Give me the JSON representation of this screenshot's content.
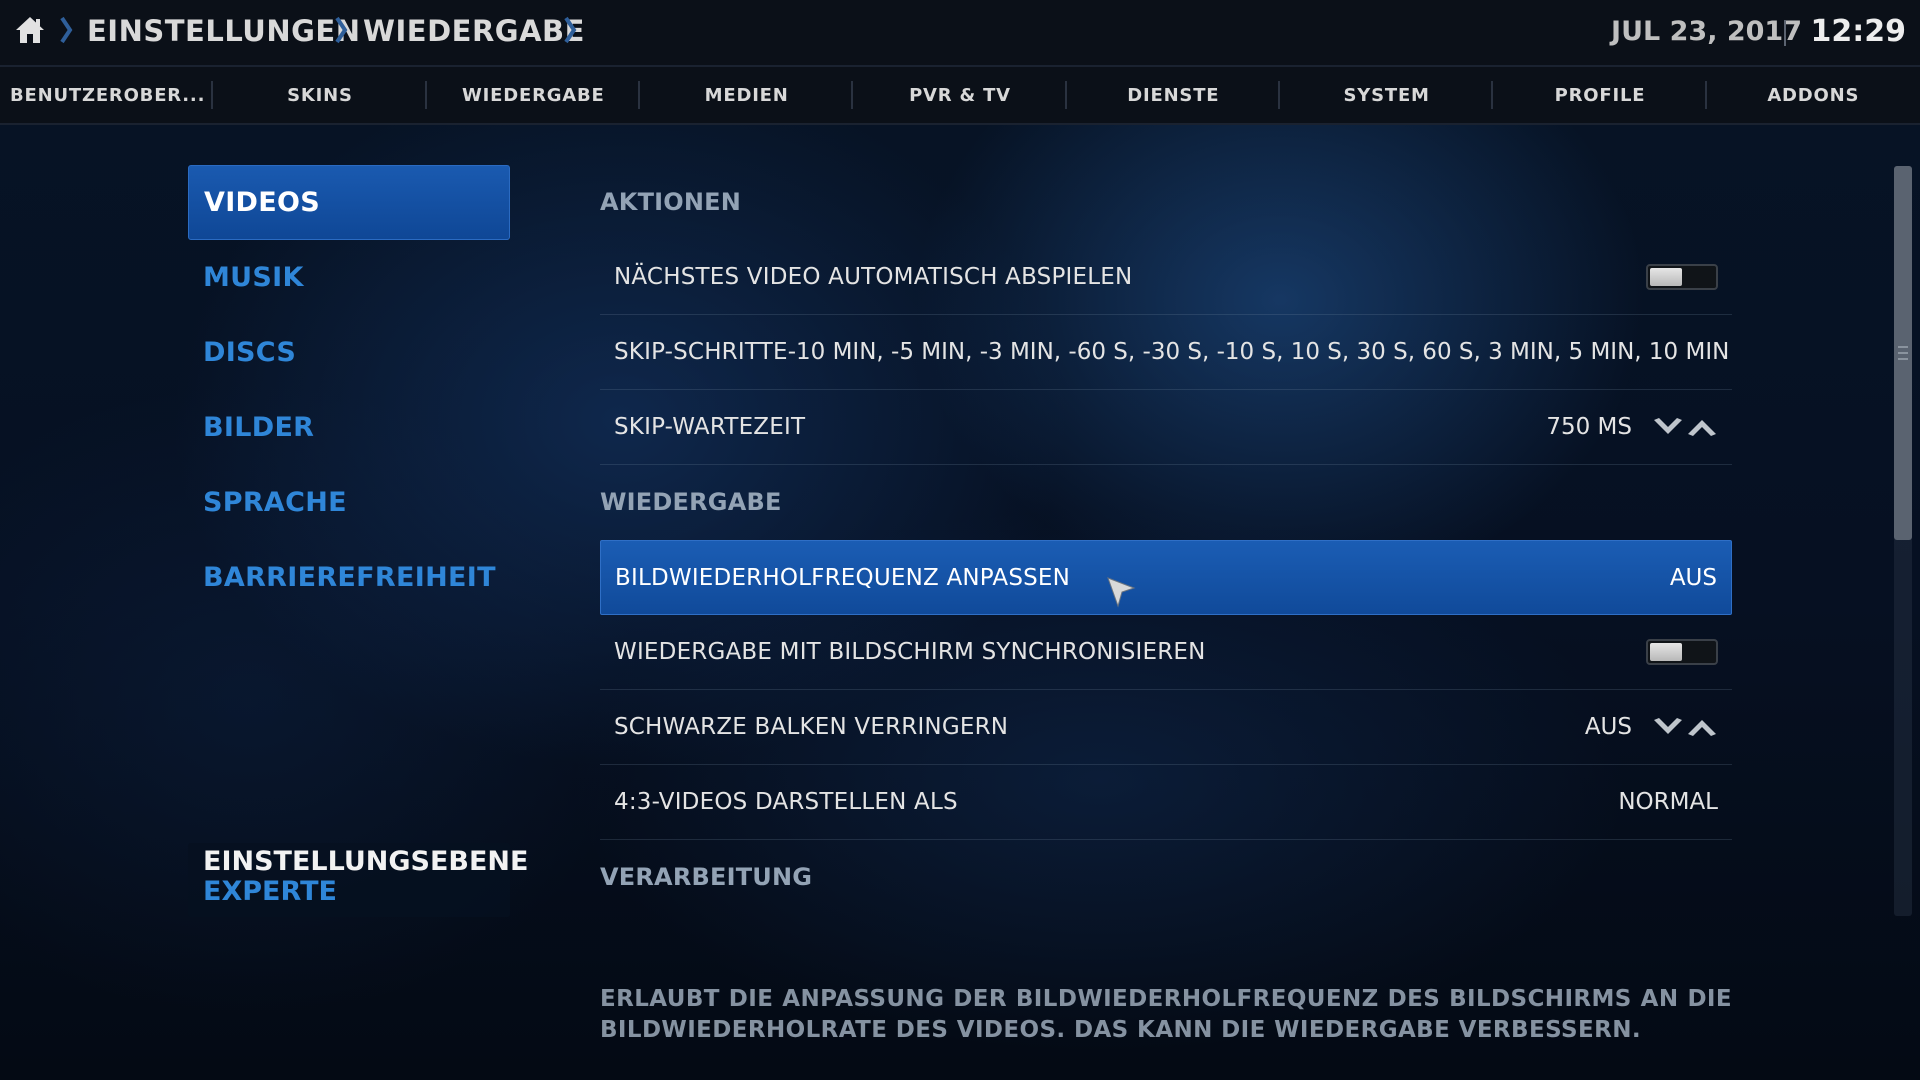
{
  "header": {
    "breadcrumb": [
      "EINSTELLUNGEN",
      "WIEDERGABE"
    ],
    "date": "JUL 23, 2017",
    "time": "12:29"
  },
  "tabs": [
    {
      "label": "BENUTZEROBER..."
    },
    {
      "label": "SKINS"
    },
    {
      "label": "WIEDERGABE"
    },
    {
      "label": "MEDIEN"
    },
    {
      "label": "PVR & TV"
    },
    {
      "label": "DIENSTE"
    },
    {
      "label": "SYSTEM"
    },
    {
      "label": "PROFILE"
    },
    {
      "label": "ADDONS"
    }
  ],
  "categories": [
    {
      "label": "VIDEOS",
      "active": true
    },
    {
      "label": "MUSIK"
    },
    {
      "label": "DISCS"
    },
    {
      "label": "BILDER"
    },
    {
      "label": "SPRACHE"
    },
    {
      "label": "BARRIEREFREIHEIT"
    }
  ],
  "settings_level": {
    "label": "EINSTELLUNGSEBENE",
    "value": "EXPERTE"
  },
  "sections": {
    "actions": "AKTIONEN",
    "playback": "WIEDERGABE",
    "processing": "VERARBEITUNG"
  },
  "settings": {
    "autoplay_next": {
      "label": "NÄCHSTES VIDEO AUTOMATISCH ABSPIELEN",
      "enabled": false
    },
    "skip_steps": {
      "label": "SKIP-SCHRITTE",
      "value": "-10 MIN, -5 MIN, -3 MIN, -60 S, -30 S, -10 S, 10 S, 30 S, 60 S, 3 MIN, 5 MIN, 10 MIN"
    },
    "skip_delay": {
      "label": "SKIP-WARTEZEIT",
      "value": "750 MS"
    },
    "adjust_refresh": {
      "label": "BILDWIEDERHOLFREQUENZ ANPASSEN",
      "value": "AUS"
    },
    "sync_display": {
      "label": "WIEDERGABE MIT BILDSCHIRM SYNCHRONISIEREN",
      "enabled": false
    },
    "reduce_black_bars": {
      "label": "SCHWARZE BALKEN VERRINGERN",
      "value": "AUS"
    },
    "display_43": {
      "label": "4:3-VIDEOS DARSTELLEN ALS",
      "value": "NORMAL"
    }
  },
  "description": "ERLAUBT DIE ANPASSUNG DER BILDWIEDERHOLFREQUENZ DES BILDSCHIRMS AN DIE BILDWIEDERHOLRATE DES VIDEOS. DAS KANN DIE WIEDERGABE VERBESSERN.",
  "colors": {
    "accent": "#2f86d8",
    "focus": "#1b5db4"
  },
  "scroll_fraction": 0.5
}
